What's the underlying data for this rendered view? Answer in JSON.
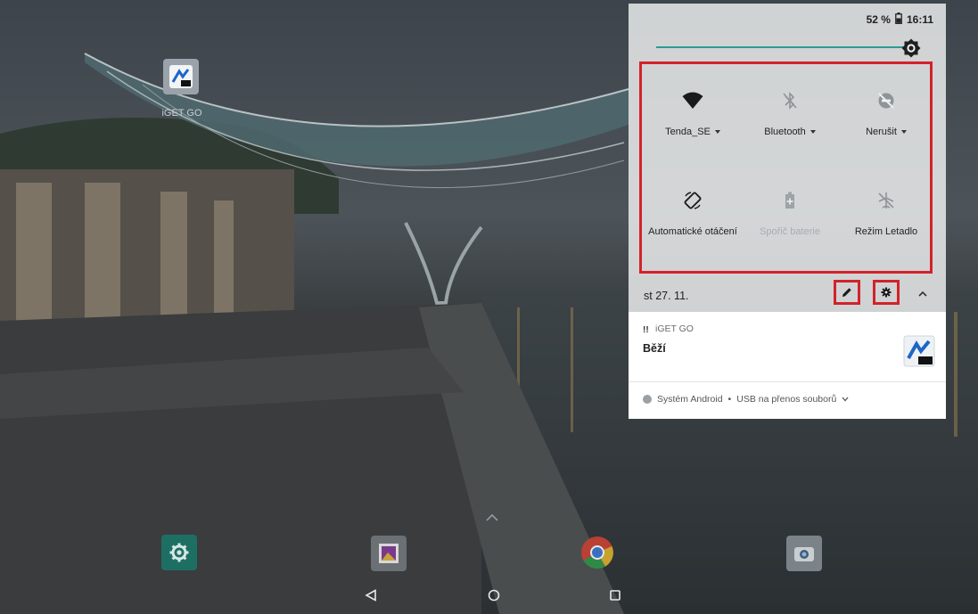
{
  "status_bar": {
    "battery": "52 %",
    "time": "16:11"
  },
  "brightness": {
    "level": 0.98
  },
  "quick_settings": {
    "tiles": [
      {
        "label": "Tenda_SE",
        "icon": "wifi-icon",
        "dropdown": true,
        "enabled": true
      },
      {
        "label": "Bluetooth",
        "icon": "bluetooth-off-icon",
        "dropdown": true,
        "enabled": false
      },
      {
        "label": "Nerušit",
        "icon": "do-not-disturb-off-icon",
        "dropdown": true,
        "enabled": false
      },
      {
        "label": "Automatické otáčení",
        "icon": "auto-rotate-icon",
        "dropdown": false,
        "enabled": true
      },
      {
        "label": "Spořič baterie",
        "icon": "battery-saver-icon",
        "dropdown": false,
        "enabled": false
      },
      {
        "label": "Režim Letadlo",
        "icon": "airplane-off-icon",
        "dropdown": false,
        "enabled": false
      }
    ],
    "date": "st 27. 11.",
    "highlight_color": "#d3222a",
    "accent_color": "#2d9b91"
  },
  "notifications": [
    {
      "app": "iGET GO",
      "title": "Běží"
    }
  ],
  "system_notification": {
    "app": "Systém Android",
    "separator": "•",
    "text": "USB na přenos souborů"
  },
  "home": {
    "shortcut_label": "iGET GO",
    "dock_apps": [
      "settings-icon",
      "gallery-icon",
      "chrome-icon",
      "camera-icon"
    ]
  }
}
